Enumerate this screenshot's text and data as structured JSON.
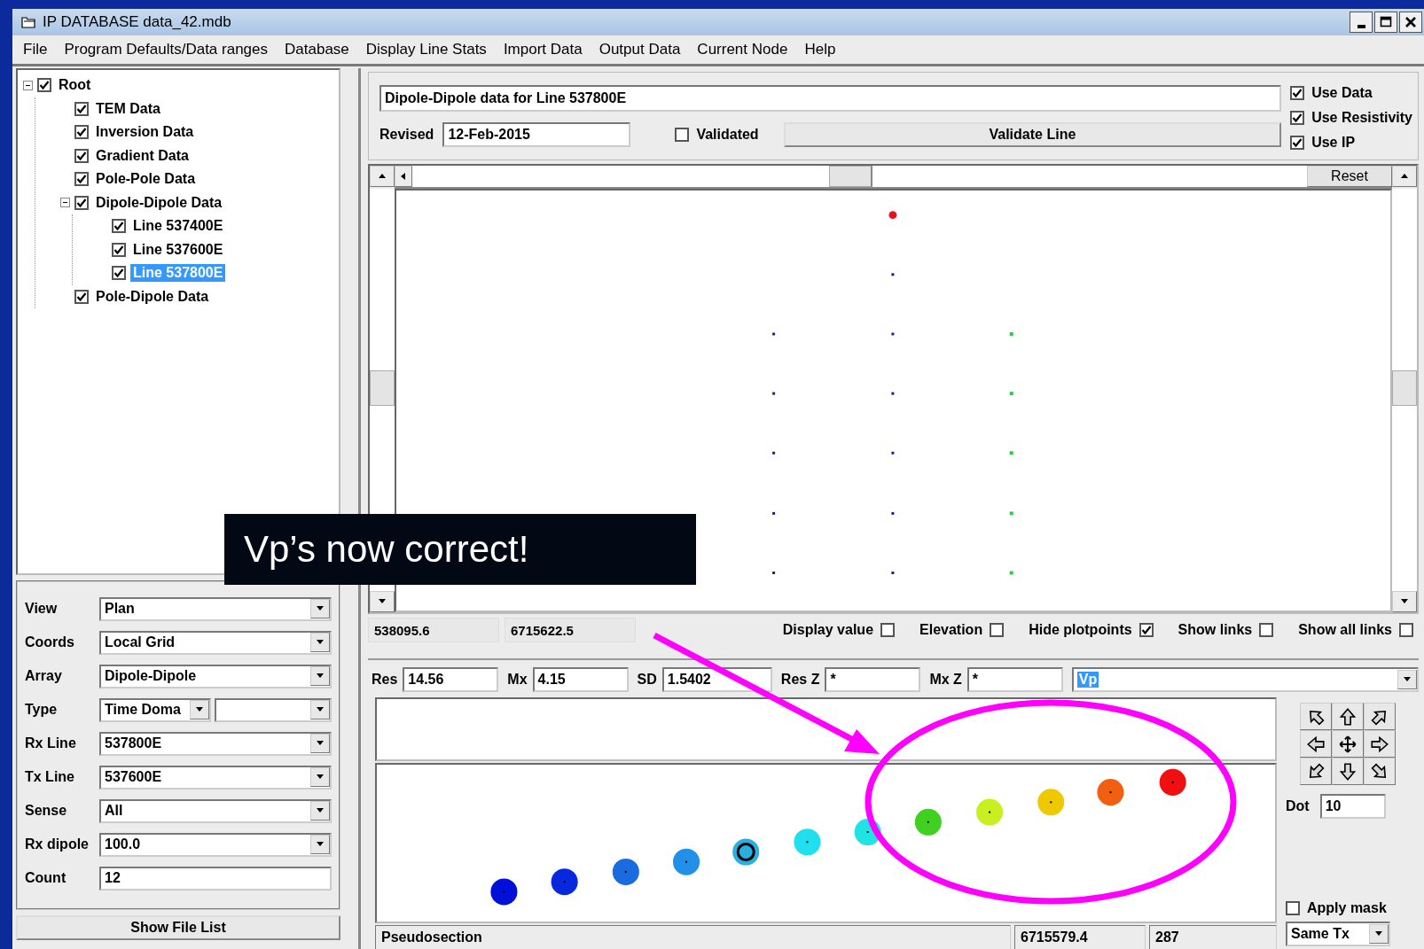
{
  "window": {
    "title": "IP DATABASE data_42.mdb"
  },
  "menu": [
    "File",
    "Program Defaults/Data ranges",
    "Database",
    "Display Line Stats",
    "Import Data",
    "Output Data",
    "Current Node",
    "Help"
  ],
  "tree": [
    {
      "label": "Root",
      "checked": true,
      "expanded": true,
      "selected": false,
      "children": [
        {
          "label": "TEM Data",
          "checked": true,
          "selected": false
        },
        {
          "label": "Inversion Data",
          "checked": true,
          "selected": false
        },
        {
          "label": "Gradient Data",
          "checked": true,
          "selected": false
        },
        {
          "label": "Pole-Pole Data",
          "checked": true,
          "selected": false
        },
        {
          "label": "Dipole-Dipole Data",
          "checked": true,
          "expanded": true,
          "selected": false,
          "children": [
            {
              "label": "Line 537400E",
              "checked": true,
              "selected": false
            },
            {
              "label": "Line 537600E",
              "checked": true,
              "selected": false
            },
            {
              "label": "Line 537800E",
              "checked": true,
              "selected": true
            }
          ]
        },
        {
          "label": "Pole-Dipole Data",
          "checked": true,
          "selected": false
        }
      ]
    }
  ],
  "form": [
    {
      "label": "View",
      "kind": "dropdown",
      "value": "Plan"
    },
    {
      "label": "Coords",
      "kind": "dropdown",
      "value": "Local Grid"
    },
    {
      "label": "Array",
      "kind": "dropdown",
      "value": "Dipole-Dipole"
    },
    {
      "label": "Type",
      "kind": "double",
      "value": "Time Doma"
    },
    {
      "label": "Rx Line",
      "kind": "dropdown",
      "value": "537800E"
    },
    {
      "label": "Tx Line",
      "kind": "dropdown",
      "value": "537600E"
    },
    {
      "label": "Sense",
      "kind": "dropdown",
      "value": "All"
    },
    {
      "label": "Rx dipole",
      "kind": "dropdown",
      "value": "100.0"
    },
    {
      "label": "Count",
      "kind": "field",
      "value": "12"
    }
  ],
  "show_file_list": "Show File List",
  "header": {
    "line_title": "Dipole-Dipole data for Line 537800E",
    "revised_label": "Revised",
    "revised": "12-Feb-2015",
    "validated": {
      "label": "Validated",
      "checked": false
    },
    "validate_button": "Validate Line",
    "options": [
      {
        "label": "Use Data",
        "checked": true
      },
      {
        "label": "Use Resistivity",
        "checked": true
      },
      {
        "label": "Use IP",
        "checked": true
      }
    ]
  },
  "plan_view": {
    "reset_button": "Reset"
  },
  "plan_status": {
    "easting": "538095.6",
    "northing": "6715622.5",
    "toggles": [
      {
        "label": "Display value",
        "checked": false
      },
      {
        "label": "Elevation",
        "checked": false
      },
      {
        "label": "Hide plotpoints",
        "checked": true
      },
      {
        "label": "Show links",
        "checked": false
      },
      {
        "label": "Show all links",
        "checked": false
      }
    ]
  },
  "stats": [
    {
      "label": "Res",
      "value": "14.56"
    },
    {
      "label": "Mx",
      "value": "4.15"
    },
    {
      "label": "SD",
      "value": "1.5402"
    },
    {
      "label": "Res Z",
      "value": "*"
    },
    {
      "label": "Mx Z",
      "value": "*"
    }
  ],
  "parameter": {
    "value": "Vp",
    "text_selected": true
  },
  "pseudo_controls": {
    "dot_label": "Dot",
    "dot": "10",
    "apply_mask": {
      "label": "Apply mask",
      "checked": false
    },
    "filter": "Same Tx"
  },
  "status_bar": [
    "Pseudosection",
    "6715579.4",
    "287"
  ],
  "annotation": {
    "callout": "Vp’s now correct!"
  }
}
